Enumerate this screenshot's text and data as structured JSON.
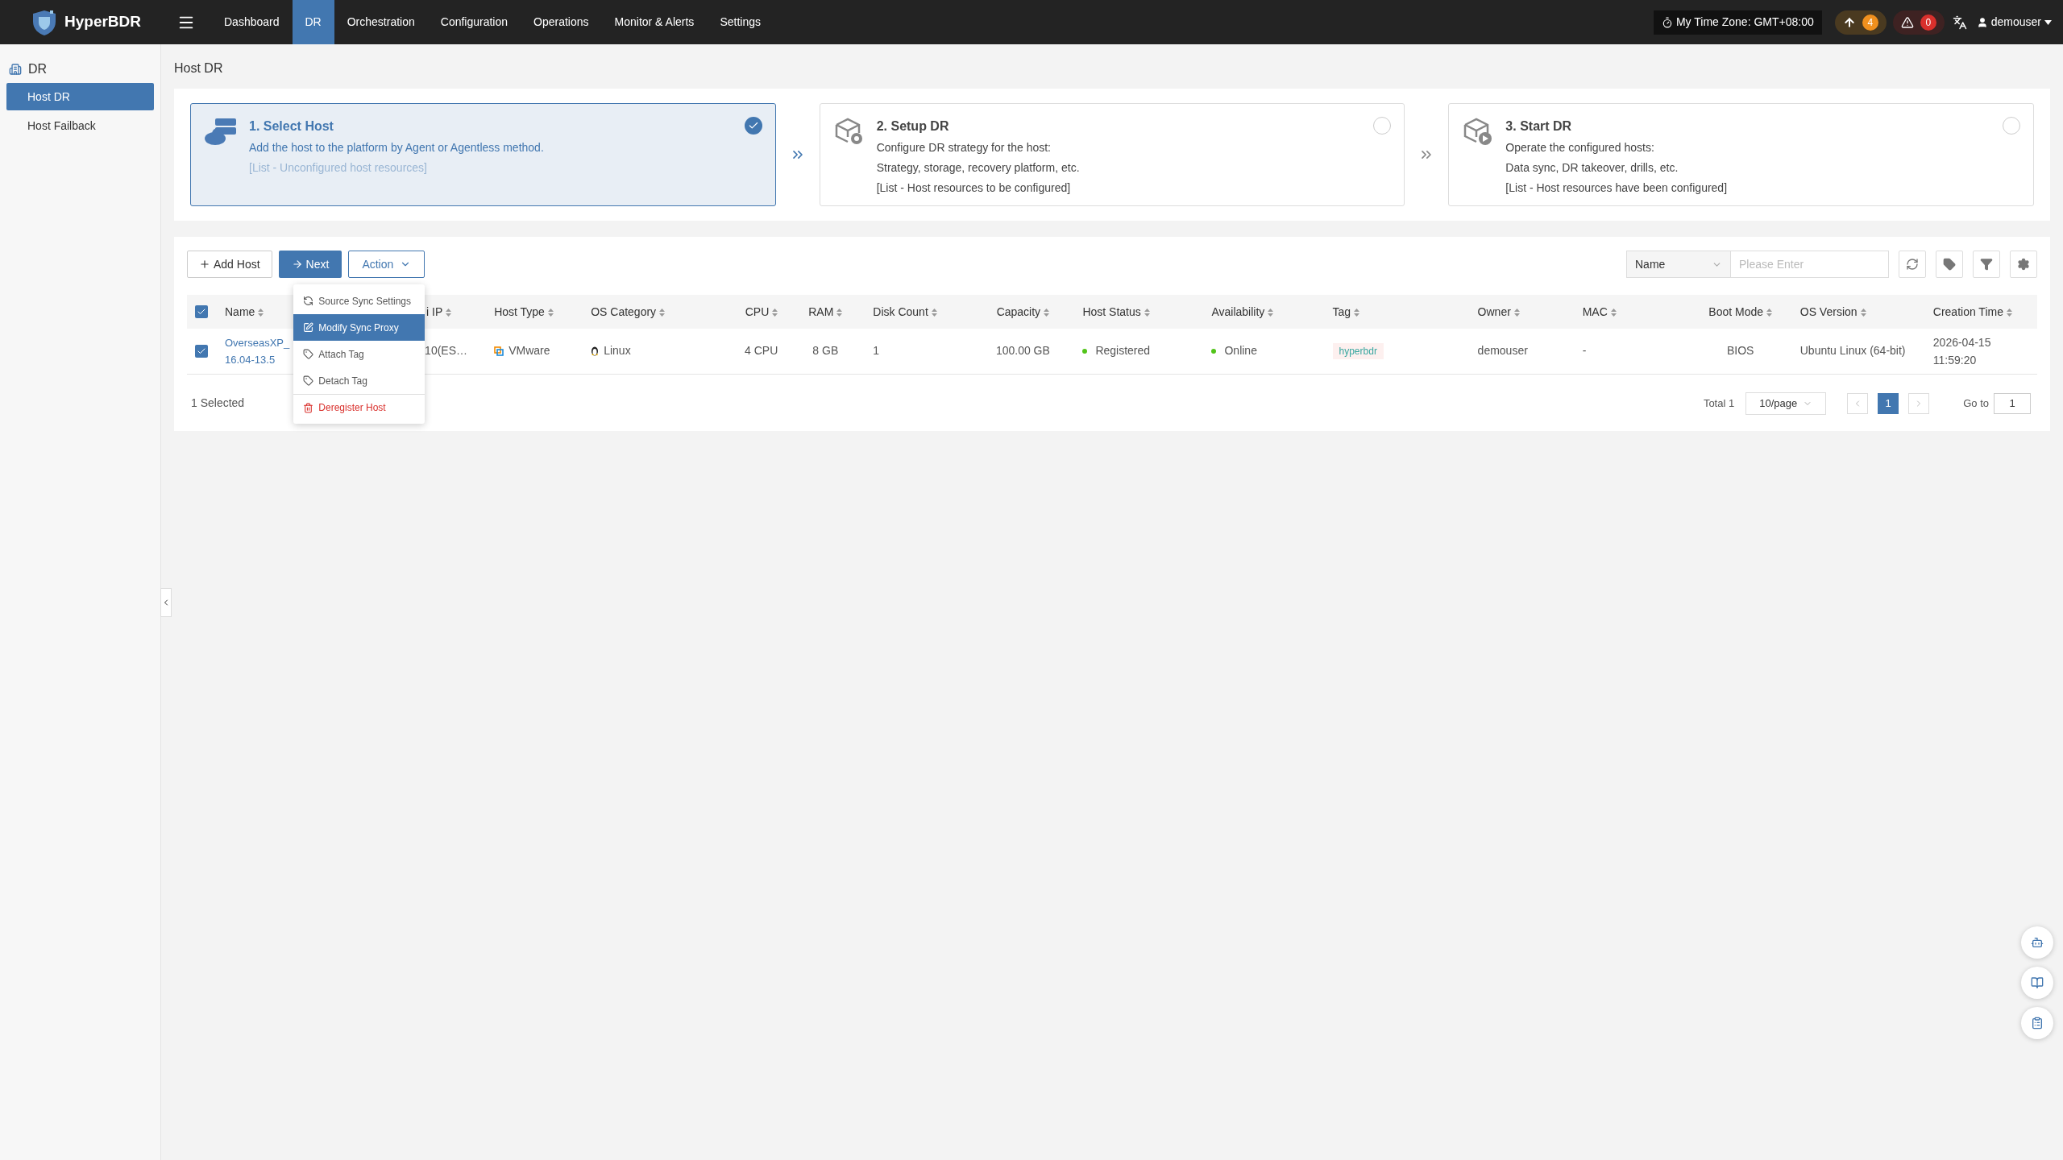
{
  "app": {
    "name": "HyperBDR"
  },
  "nav": [
    {
      "label": "Dashboard",
      "selected": false
    },
    {
      "label": "DR",
      "selected": true
    },
    {
      "label": "Orchestration",
      "selected": false
    },
    {
      "label": "Configuration",
      "selected": false
    },
    {
      "label": "Operations",
      "selected": false
    },
    {
      "label": "Monitor & Alerts",
      "selected": false
    },
    {
      "label": "Settings",
      "selected": false
    }
  ],
  "header": {
    "timezone": "My Time Zone: GMT+08:00",
    "uploads": "4",
    "alerts": "0",
    "user": "demouser"
  },
  "sidebar": {
    "title": "DR",
    "items": [
      {
        "label": "Host DR",
        "selected": true
      },
      {
        "label": "Host Failback",
        "selected": false
      }
    ]
  },
  "page_title": "Host DR",
  "steps": [
    {
      "title": "1. Select Host",
      "lines": [
        "Add the host to the platform by Agent or Agentless method."
      ],
      "note": "[List - Unconfigured host resources]",
      "selected": true,
      "done": true,
      "kind": "host"
    },
    {
      "title": "2. Setup DR",
      "lines": [
        "Configure DR strategy for the host:",
        "Strategy, storage, recovery platform, etc."
      ],
      "note": "[List - Host resources to be configured]",
      "selected": false,
      "done": false,
      "kind": "setup"
    },
    {
      "title": "3. Start DR",
      "lines": [
        "Operate the configured hosts:",
        "Data sync, DR takeover, drills, etc."
      ],
      "note": "[List - Host resources have been configured]",
      "selected": false,
      "done": false,
      "kind": "start"
    }
  ],
  "toolbar": {
    "add": "Add Host",
    "next": "Next",
    "action": "Action",
    "search_field": "Name",
    "search_placeholder": "Please Enter"
  },
  "action_menu": [
    {
      "label": "Source Sync Settings",
      "kind": "sync",
      "selected": false,
      "danger": false
    },
    {
      "label": "Modify Sync Proxy",
      "kind": "edit",
      "selected": true,
      "danger": false
    },
    {
      "label": "Attach Tag",
      "kind": "tag",
      "selected": false,
      "danger": false
    },
    {
      "label": "Detach Tag",
      "kind": "untag",
      "selected": false,
      "danger": false
    },
    {
      "label": "Deregister Host",
      "kind": "trash",
      "selected": false,
      "danger": true
    }
  ],
  "table": {
    "all_checked": true,
    "columns": [
      "Name",
      "i IP",
      "Host Type",
      "OS Category",
      "CPU",
      "RAM",
      "Disk Count",
      "Capacity",
      "Host Status",
      "Availability",
      "Tag",
      "Owner",
      "MAC",
      "Boot Mode",
      "OS Version",
      "Creation Time"
    ],
    "rows": [
      {
        "checked": true,
        "name": "OverseasXP_ 16.04-13.5",
        "ip": "10(ES…",
        "host_type": "VMware",
        "os_category": "Linux",
        "cpu": "4 CPU",
        "ram": "8 GB",
        "disk_count": "1",
        "capacity": "100.00 GB",
        "host_status": {
          "label": "Registered",
          "color": "#52c41a"
        },
        "availability": {
          "label": "Online",
          "color": "#52c41a"
        },
        "tag": "hyperbdr",
        "owner": "demouser",
        "mac": "-",
        "boot_mode": "BIOS",
        "os_version": "Ubuntu Linux (64-bit)",
        "creation_time": "2026-04-15 11:59:20"
      }
    ]
  },
  "footer": {
    "selected_count": "1 Selected",
    "total": "Total 1",
    "page_size": "10/page",
    "pages": [
      {
        "label": "1",
        "selected": true
      }
    ],
    "goto_label": "Go to",
    "goto_value": "1"
  }
}
